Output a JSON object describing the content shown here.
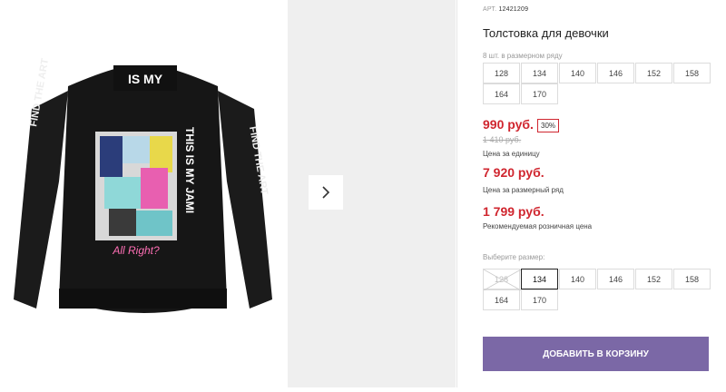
{
  "product": {
    "art_label": "АРТ.",
    "art_number": "12421209",
    "title": "Толстовка для девочки"
  },
  "pack": {
    "label": "8 шт. в размерном ряду",
    "sizes": [
      "128",
      "134",
      "140",
      "146",
      "152",
      "158",
      "164",
      "170"
    ]
  },
  "pricing": {
    "price": "990 руб.",
    "discount": "30%",
    "old_price": "1 410 руб.",
    "unit_caption": "Цена за единицу",
    "row_price": "7 920 руб.",
    "row_caption": "Цена за размерный ряд",
    "rrp_price": "1 799 руб.",
    "rrp_caption": "Рекомендуемая розничная цена"
  },
  "size_select": {
    "label": "Выберите размер:",
    "sizes": [
      "128",
      "134",
      "140",
      "146",
      "152",
      "158",
      "164",
      "170"
    ],
    "selected": "134",
    "unavailable": [
      "128"
    ]
  },
  "actions": {
    "add_to_cart": "ДОБАВИТЬ В КОРЗИНУ"
  },
  "gallery": {
    "jacket_collar_text": "IS MY",
    "jacket_back_text": "THIS IS MY JAMI",
    "jacket_sleeve_text": "FIND THE ART",
    "next_icon": "chevron-right-icon"
  },
  "colors": {
    "price": "#d0262f",
    "button": "#7b68a6"
  }
}
